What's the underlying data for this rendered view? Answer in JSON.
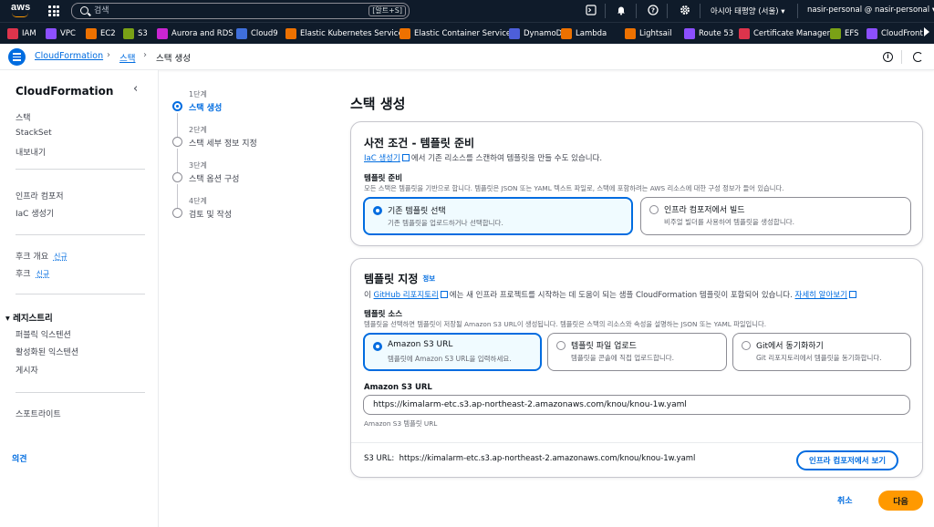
{
  "topbar": {
    "logo": "aws",
    "search_placeholder": "검색",
    "search_shortcut": "[알트+S]",
    "region": "아시아 태평양 (서울)",
    "account": "nasir-personal @ nasir-personal",
    "icons": [
      "cloudshell-icon",
      "bell-icon",
      "help-icon",
      "gear-icon"
    ]
  },
  "favorites": [
    {
      "label": "IAM",
      "color": "#dd344c",
      "icon": "iam-icon"
    },
    {
      "label": "VPC",
      "color": "#8c4fff",
      "icon": "vpc-icon"
    },
    {
      "label": "EC2",
      "color": "#ed7100",
      "icon": "ec2-icon"
    },
    {
      "label": "S3",
      "color": "#7aa116",
      "icon": "s3-icon"
    },
    {
      "label": "Aurora and RDS",
      "color": "#c925d1",
      "icon": "rds-icon"
    },
    {
      "label": "Cloud9",
      "color": "#3f6fdb",
      "icon": "cloud9-icon"
    },
    {
      "label": "Elastic Kubernetes Service",
      "color": "#ed7100",
      "icon": "eks-icon"
    },
    {
      "label": "Elastic Container Service",
      "color": "#ed7100",
      "icon": "ecs-icon"
    },
    {
      "label": "DynamoDB",
      "color": "#4d5fd9",
      "icon": "dynamodb-icon"
    },
    {
      "label": "Lambda",
      "color": "#ed7100",
      "icon": "lambda-icon"
    },
    {
      "label": "Lightsail",
      "color": "#ed7100",
      "icon": "lightsail-icon"
    },
    {
      "label": "Route 53",
      "color": "#8c4fff",
      "icon": "route53-icon"
    },
    {
      "label": "Certificate Manager",
      "color": "#dd344c",
      "icon": "acm-icon"
    },
    {
      "label": "EFS",
      "color": "#7aa116",
      "icon": "efs-icon"
    },
    {
      "label": "CloudFront",
      "color": "#8c4fff",
      "icon": "cloudfront-icon"
    }
  ],
  "breadcrumb": {
    "items": [
      "CloudFormation",
      "스택",
      "스택 생성"
    ]
  },
  "sidebar": {
    "title": "CloudFormation",
    "group1": [
      "스택",
      "StackSet",
      "내보내기"
    ],
    "group2": [
      "인프라 컴포저",
      "IaC 생성기"
    ],
    "group3": [
      {
        "label": "후크 개요",
        "badge": "신규"
      },
      {
        "label": "후크",
        "badge": "신규"
      }
    ],
    "registry_head": "레지스트리",
    "registry_items": [
      "퍼블릭 익스텐션",
      "활성화된 익스텐션",
      "게시자"
    ],
    "spotlight": "스포트라이트",
    "feedback": "의견"
  },
  "steps": [
    {
      "num": "1단계",
      "label": "스택 생성",
      "active": true
    },
    {
      "num": "2단계",
      "label": "스택 세부 정보 지정",
      "active": false
    },
    {
      "num": "3단계",
      "label": "스택 옵션 구성",
      "active": false
    },
    {
      "num": "4단계",
      "label": "검토 및 작성",
      "active": false
    }
  ],
  "page": {
    "title": "스택 생성",
    "prereq": {
      "heading": "사전 조건 - 템플릿 준비",
      "sub_link": "IaC 생성기",
      "sub_rest": "에서 기존 리소스를 스캔하여 템플릿을 만들 수도 있습니다.",
      "field_label": "템플릿 준비",
      "field_desc": "모든 스택은 템플릿을 기반으로 합니다. 템플릿은 JSON 또는 YAML 텍스트 파일로, 스택에 포함하려는 AWS 리소스에 대한 구성 정보가 들어 있습니다.",
      "options": [
        {
          "title": "기존 템플릿 선택",
          "desc": "기존 템플릿을 업로드하거나 선택합니다.",
          "selected": true
        },
        {
          "title": "인프라 컴포저에서 빌드",
          "desc": "비주얼 빌더를 사용하여 템플릿을 생성합니다.",
          "selected": false
        }
      ]
    },
    "template": {
      "heading": "템플릿 지정",
      "info": "정보",
      "sub_pre": "이 ",
      "sub_link": "GitHub 리포지토리",
      "sub_rest": "에는 새 인프라 프로젝트를 시작하는 데 도움이 되는 샘플 CloudFormation 템플릿이 포함되어 있습니다.",
      "learn_more": "자세히 알아보기",
      "source_label": "템플릿 소스",
      "source_desc": "템플릿을 선택하면 템플릿이 저장될 Amazon S3 URL이 생성됩니다. 템플릿은 스택의 리소스와 속성을 설명하는 JSON 또는 YAML 파일입니다.",
      "options": [
        {
          "title": "Amazon S3 URL",
          "desc": "템플릿에 Amazon S3 URL을 입력하세요.",
          "selected": true
        },
        {
          "title": "템플릿 파일 업로드",
          "desc": "템플릿을 콘솔에 직접 업로드합니다.",
          "selected": false
        },
        {
          "title": "Git에서 동기화하기",
          "desc": "Git 리포지토리에서 템플릿을 동기화합니다.",
          "selected": false
        }
      ],
      "s3_label": "Amazon S3 URL",
      "s3_value": "https://kimalarm-etc.s3.ap-northeast-2.amazonaws.com/knou/knou-1w.yaml",
      "s3_hint": "Amazon S3 템플릿 URL",
      "footer_prefix": "S3 URL:",
      "footer_url": "https://kimalarm-etc.s3.ap-northeast-2.amazonaws.com/knou/knou-1w.yaml",
      "view_button": "인프라 컴포저에서 보기"
    },
    "cancel": "취소",
    "next": "다음"
  }
}
